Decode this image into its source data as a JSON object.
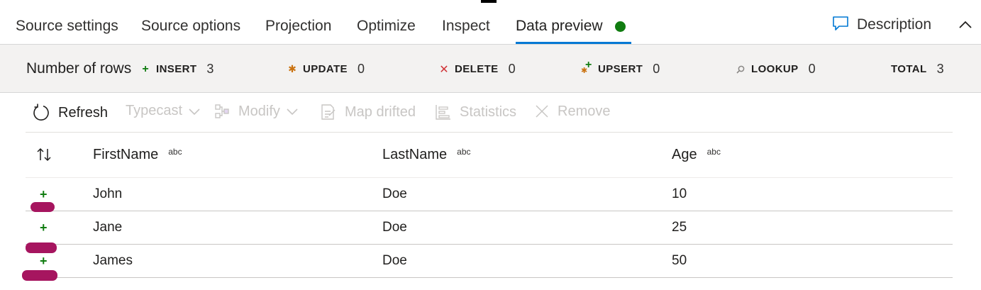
{
  "tabs": [
    {
      "label": "Source settings"
    },
    {
      "label": "Source options"
    },
    {
      "label": "Projection"
    },
    {
      "label": "Optimize"
    },
    {
      "label": "Inspect"
    },
    {
      "label": "Data preview"
    }
  ],
  "active_tab": "Data preview",
  "status_color": "#107c10",
  "description_label": "Description",
  "rows_bar": {
    "title": "Number of rows",
    "stats": [
      {
        "name": "INSERT",
        "value": "3",
        "icon": "plus-icon",
        "color": "#107c10"
      },
      {
        "name": "UPDATE",
        "value": "0",
        "icon": "asterisk-icon",
        "color": "#ca7311"
      },
      {
        "name": "DELETE",
        "value": "0",
        "icon": "x-icon",
        "color": "#d13438"
      },
      {
        "name": "UPSERT",
        "value": "0",
        "icon": "plus-asterisk-icon",
        "color": "#107c10"
      },
      {
        "name": "LOOKUP",
        "value": "0",
        "icon": "search-icon",
        "color": "#8a8886"
      },
      {
        "name": "TOTAL",
        "value": "3"
      }
    ]
  },
  "toolbar": {
    "refresh": "Refresh",
    "typecast": "Typecast",
    "modify": "Modify",
    "map_drifted": "Map drifted",
    "statistics": "Statistics",
    "remove": "Remove"
  },
  "table": {
    "columns": [
      {
        "name": "FirstName",
        "type": "abc"
      },
      {
        "name": "LastName",
        "type": "abc"
      },
      {
        "name": "Age",
        "type": "abc"
      }
    ],
    "rows": [
      {
        "status": "+",
        "cells": [
          "John",
          "Doe",
          "10"
        ]
      },
      {
        "status": "+",
        "cells": [
          "Jane",
          "Doe",
          "25"
        ]
      },
      {
        "status": "+",
        "cells": [
          "James",
          "Doe",
          "50"
        ]
      }
    ]
  }
}
